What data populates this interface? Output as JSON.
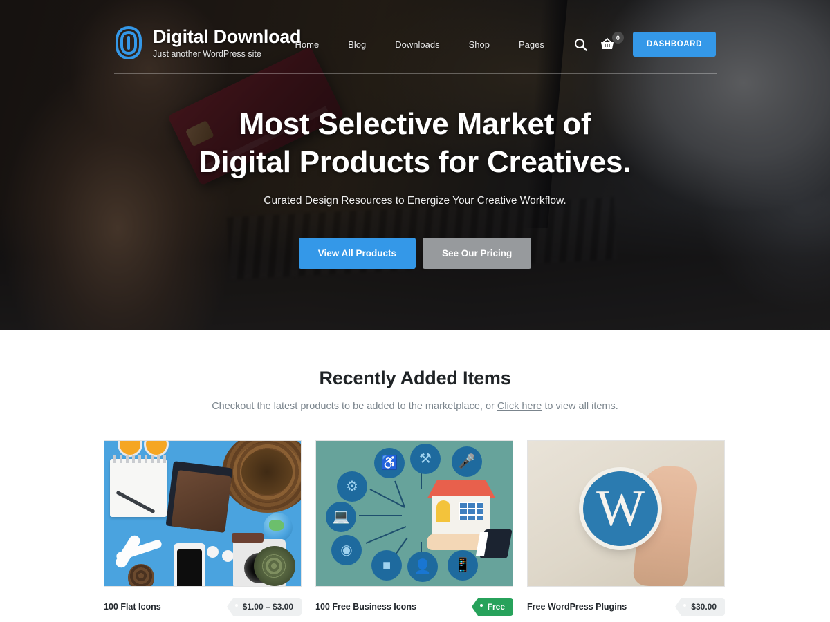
{
  "site": {
    "brand_title": "Digital Download",
    "brand_tagline": "Just another WordPress site",
    "logo_icon": "fingerprint-icon",
    "accent_color": "#3498e8",
    "free_badge_color": "#27a25b"
  },
  "nav": {
    "items": [
      {
        "label": "Home"
      },
      {
        "label": "Blog"
      },
      {
        "label": "Downloads"
      },
      {
        "label": "Shop"
      },
      {
        "label": "Pages"
      }
    ],
    "search_icon": "search-icon",
    "cart_icon": "shopping-basket-icon",
    "cart_count": "0",
    "dashboard_label": "DASHBOARD"
  },
  "hero": {
    "title_line1": "Most Selective Market of",
    "title_line2": "Digital Products for Creatives.",
    "subtitle": "Curated Design Resources to Energize Your Creative Workflow.",
    "primary_button": "View All Products",
    "secondary_button": "See Our Pricing"
  },
  "recent": {
    "heading": "Recently Added Items",
    "sub_before": "Checkout the latest products to be added to the marketplace, or ",
    "sub_link": "Click here",
    "sub_after": " to view all items.",
    "items": [
      {
        "title": "100 Flat Icons",
        "price": "$1.00 – $3.00",
        "free": false,
        "image_alt": "travel-flat-lay-photo"
      },
      {
        "title": "100 Free Business Icons",
        "price": "Free",
        "free": true,
        "image_alt": "smart-home-icons-illustration"
      },
      {
        "title": "Free WordPress Plugins",
        "price": "$30.00",
        "free": false,
        "image_alt": "hand-holding-wordpress-logo-photo"
      }
    ]
  }
}
